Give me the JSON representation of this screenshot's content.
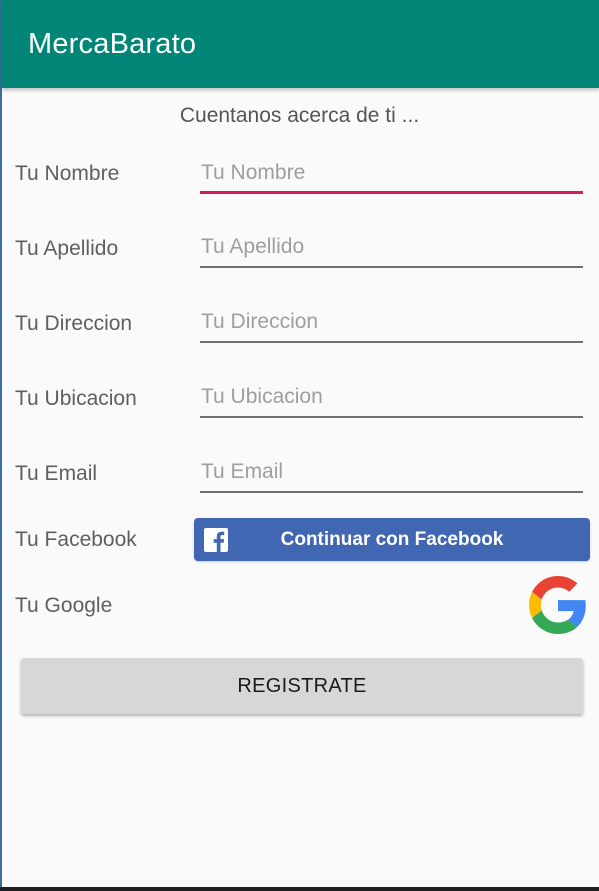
{
  "app": {
    "title": "MercaBarato"
  },
  "form": {
    "subtitle": "Cuentanos acerca de ti ...",
    "fields": [
      {
        "label": "Tu Nombre",
        "placeholder": "Tu Nombre",
        "value": ""
      },
      {
        "label": "Tu Apellido",
        "placeholder": "Tu Apellido",
        "value": ""
      },
      {
        "label": "Tu Direccion",
        "placeholder": "Tu Direccion",
        "value": ""
      },
      {
        "label": "Tu Ubicacion",
        "placeholder": "Tu Ubicacion",
        "value": ""
      },
      {
        "label": "Tu Email",
        "placeholder": "Tu Email",
        "value": ""
      }
    ],
    "facebook": {
      "label": "Tu Facebook",
      "button": "Continuar con Facebook",
      "icon": "facebook-icon",
      "color": "#4267b2"
    },
    "google": {
      "label": "Tu Google",
      "icon": "google-icon"
    },
    "register_button": "REGISTRATE"
  },
  "colors": {
    "appbar": "#008577",
    "focus_underline": "#d81b60",
    "facebook": "#4267b2"
  }
}
